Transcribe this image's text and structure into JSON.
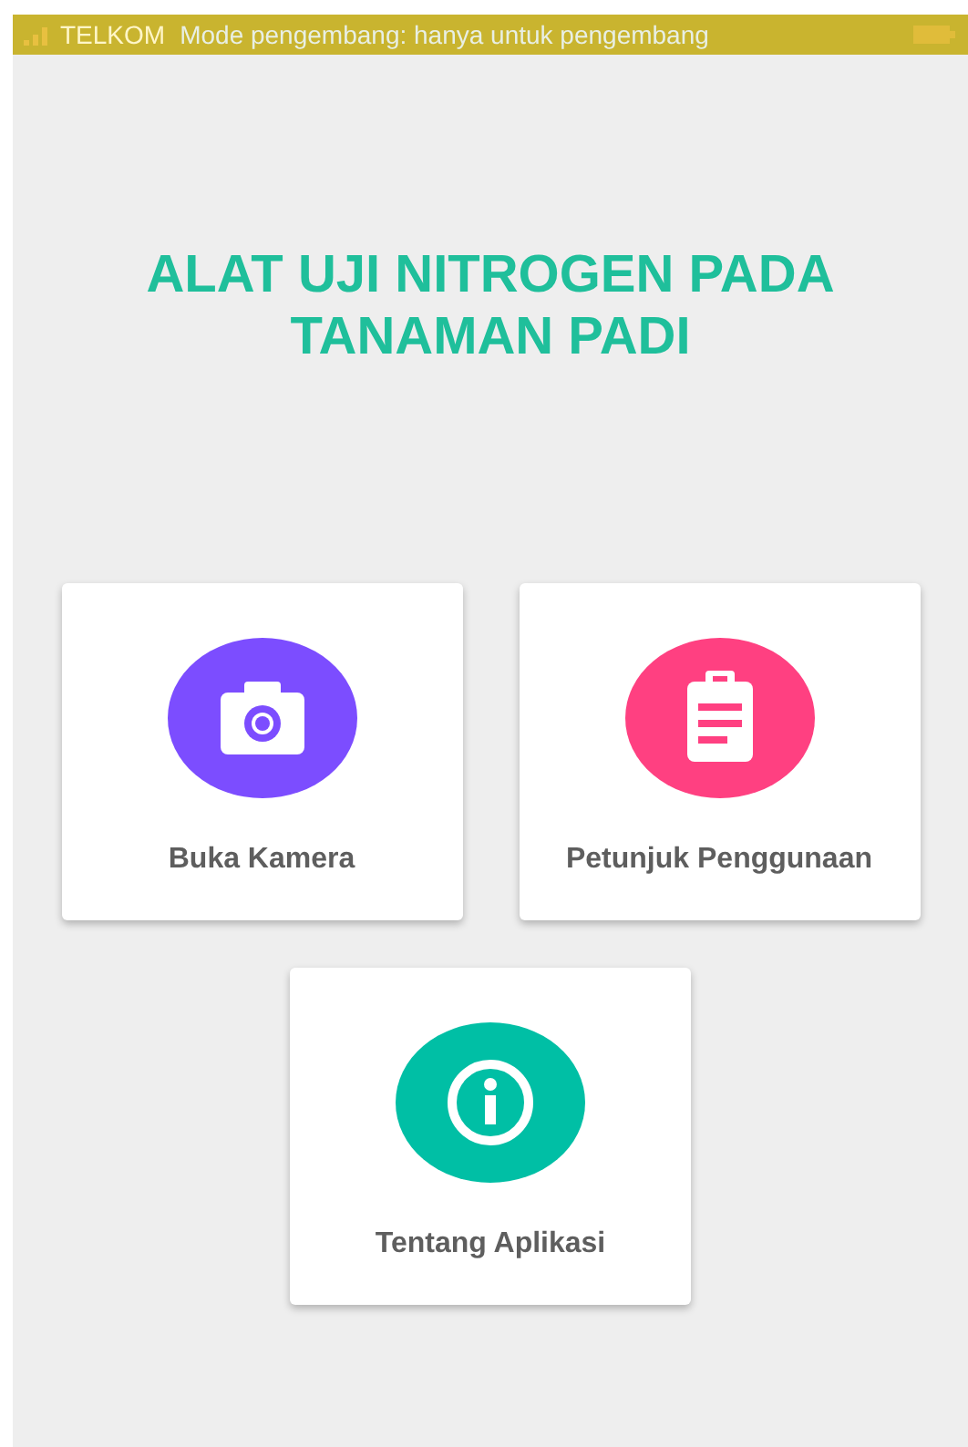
{
  "status_bar": {
    "carrier": "TELKOM",
    "notice": "Mode pengembang: hanya untuk pengembang"
  },
  "title": "ALAT UJI NITROGEN PADA TANAMAN PADI",
  "menu": [
    {
      "label": "Buka Kamera",
      "kind": "camera",
      "color": "#7c4dff"
    },
    {
      "label": "Petunjuk Penggunaan",
      "kind": "clipboard",
      "color": "#ff4081"
    },
    {
      "label": "Tentang Aplikasi",
      "kind": "info",
      "color": "#00bfa5"
    }
  ]
}
